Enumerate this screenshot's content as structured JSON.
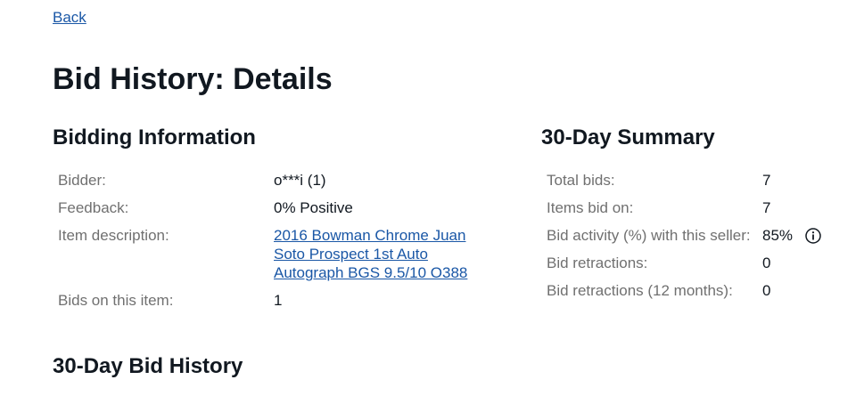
{
  "nav": {
    "back_label": "Back"
  },
  "page": {
    "title": "Bid History: Details"
  },
  "bidding_info": {
    "heading": "Bidding Information",
    "rows": [
      {
        "label": "Bidder:",
        "value": "o***i (1)"
      },
      {
        "label": "Feedback:",
        "value": "0% Positive"
      },
      {
        "label": "Item description:",
        "value": "2016 Bowman Chrome Juan Soto Prospect 1st Auto Autograph BGS 9.5/10 O388"
      },
      {
        "label": "Bids on this item:",
        "value": "1"
      }
    ]
  },
  "summary": {
    "heading": "30-Day Summary",
    "rows": [
      {
        "label": "Total bids:",
        "value": "7"
      },
      {
        "label": "Items bid on:",
        "value": "7"
      },
      {
        "label": "Bid activity (%) with this seller:",
        "value": "85%",
        "icon": "info-icon"
      },
      {
        "label": "Bid retractions:",
        "value": "0"
      },
      {
        "label": "Bid retractions (12 months):",
        "value": "0"
      }
    ]
  },
  "history": {
    "heading": "30-Day Bid History"
  },
  "colors": {
    "link": "#1a57a6",
    "label": "#707070",
    "text": "#111820"
  }
}
